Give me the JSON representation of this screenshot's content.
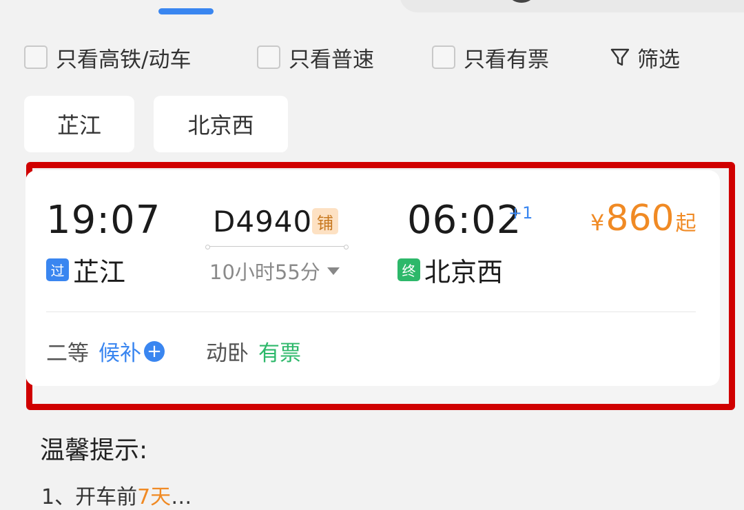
{
  "filters": {
    "high_speed_only": "只看高铁/动车",
    "regular_only": "只看普速",
    "available_only": "只看有票",
    "filter_label": "筛选"
  },
  "stations": {
    "from": "芷江",
    "to": "北京西"
  },
  "train": {
    "dep_time": "19:07",
    "dep_tag": "过",
    "dep_station": "芷江",
    "number": "D4940",
    "sleeper_tag": "铺",
    "duration": "10小时55分",
    "arr_time": "06:02",
    "day_offset": "+1",
    "arr_tag": "终",
    "arr_station": "北京西",
    "price_symbol": "¥",
    "price": "860",
    "price_suffix": "起",
    "seats": [
      {
        "class": "二等",
        "status": "候补"
      },
      {
        "class": "动卧",
        "status": "有票"
      }
    ]
  },
  "tips": {
    "title": "温馨提示:",
    "text_start": "1、开车前",
    "text_highlight": "7天",
    "text_end": "…"
  },
  "colors": {
    "accent_blue": "#3a86f0",
    "price_orange": "#f08a24",
    "available_green": "#2db86a",
    "highlight_red": "#d00000"
  }
}
